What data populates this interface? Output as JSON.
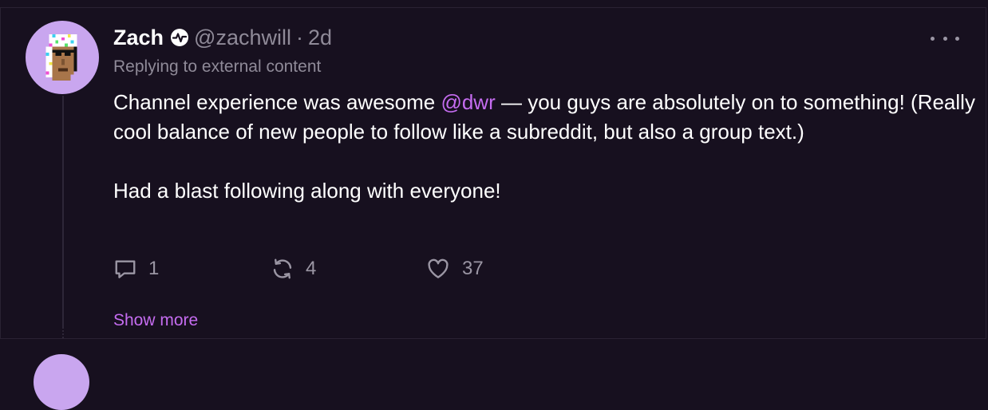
{
  "post": {
    "author_name": "Zach",
    "handle": "@zachwill",
    "separator": "·",
    "age": "2d",
    "replying_to": "Replying to external content",
    "text_before_mention": "Channel experience was awesome ",
    "mention": "@dwr",
    "text_after_mention": " — you guys are absolutely on to something! (Really cool balance of new people to follow like a subreddit, but also a group text.)",
    "text_paragraph_2": "Had a blast following along with everyone!",
    "show_more": "Show more"
  },
  "actions": {
    "replies": "1",
    "recasts": "4",
    "likes": "37"
  },
  "icons": {
    "verified": "activity-badge-icon",
    "more": "more-horizontal-icon",
    "reply": "comment-icon",
    "recast": "recast-icon",
    "like": "heart-icon"
  },
  "colors": {
    "background": "#17101f",
    "accent": "#c56cf0",
    "avatar_bg": "#c9a6ef",
    "muted_text": "#8f8a98"
  }
}
